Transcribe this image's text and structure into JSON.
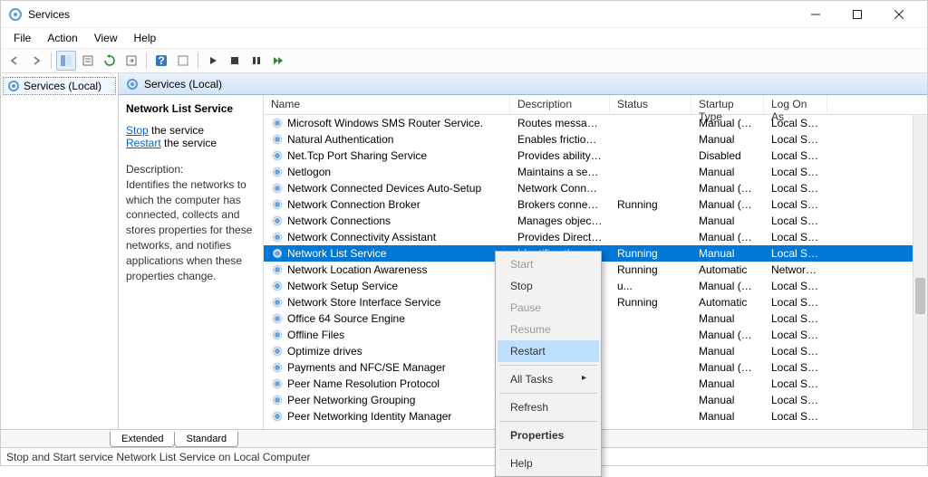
{
  "window": {
    "title": "Services"
  },
  "menubar": [
    "File",
    "Action",
    "View",
    "Help"
  ],
  "nav": {
    "item": "Services (Local)"
  },
  "main_header": {
    "label": "Services (Local)"
  },
  "detail": {
    "service_name": "Network List Service",
    "stop_prefix": "Stop",
    "stop_suffix": " the service",
    "restart_prefix": "Restart",
    "restart_suffix": " the service",
    "desc_label": "Description:",
    "desc_text": "Identifies the networks to which the computer has connected, collects and stores properties for these networks, and notifies applications when these properties change."
  },
  "columns": {
    "name": "Name",
    "desc": "Description",
    "status": "Status",
    "startup": "Startup Type",
    "logon": "Log On As"
  },
  "services": [
    {
      "name": "Microsoft Windows SMS Router Service.",
      "desc": "Routes messages...",
      "status": "",
      "startup": "Manual (Tri...",
      "logon": "Local Syst..."
    },
    {
      "name": "Natural Authentication",
      "desc": "Enables friction-fr...",
      "status": "",
      "startup": "Manual",
      "logon": "Local Syst..."
    },
    {
      "name": "Net.Tcp Port Sharing Service",
      "desc": "Provides ability t...",
      "status": "",
      "startup": "Disabled",
      "logon": "Local Serv..."
    },
    {
      "name": "Netlogon",
      "desc": "Maintains a secur...",
      "status": "",
      "startup": "Manual",
      "logon": "Local Syst..."
    },
    {
      "name": "Network Connected Devices Auto-Setup",
      "desc": "Network Connect...",
      "status": "",
      "startup": "Manual (Tri...",
      "logon": "Local Serv..."
    },
    {
      "name": "Network Connection Broker",
      "desc": "Brokers connecti...",
      "status": "Running",
      "startup": "Manual (Tri...",
      "logon": "Local Syst..."
    },
    {
      "name": "Network Connections",
      "desc": "Manages objects...",
      "status": "",
      "startup": "Manual",
      "logon": "Local Syst..."
    },
    {
      "name": "Network Connectivity Assistant",
      "desc": "Provides DirectAc...",
      "status": "",
      "startup": "Manual (Tri...",
      "logon": "Local Syst..."
    },
    {
      "name": "Network List Service",
      "desc": "Identifies the net...",
      "status": "Running",
      "startup": "Manual",
      "logon": "Local Serv...",
      "selected": true
    },
    {
      "name": "Network Location Awareness",
      "desc": "",
      "status": "Running",
      "startup": "Automatic",
      "logon": "Network ..."
    },
    {
      "name": "Network Setup Service",
      "desc": "",
      "status": "u...",
      "startup": "Manual (Tri...",
      "logon": "Local Syst..."
    },
    {
      "name": "Network Store Interface Service",
      "desc": "",
      "status": "Running",
      "startup": "Automatic",
      "logon": "Local Serv..."
    },
    {
      "name": "Office 64 Source Engine",
      "desc": "",
      "status": "",
      "startup": "Manual",
      "logon": "Local Syst..."
    },
    {
      "name": "Offline Files",
      "desc": "",
      "status": "",
      "startup": "Manual (Tri...",
      "logon": "Local Syst..."
    },
    {
      "name": "Optimize drives",
      "desc": "",
      "status": "",
      "startup": "Manual",
      "logon": "Local Syst..."
    },
    {
      "name": "Payments and NFC/SE Manager",
      "desc": "",
      "status": "",
      "startup": "Manual (Tri...",
      "logon": "Local Serv..."
    },
    {
      "name": "Peer Name Resolution Protocol",
      "desc": "",
      "status": "",
      "startup": "Manual",
      "logon": "Local Serv..."
    },
    {
      "name": "Peer Networking Grouping",
      "desc": "",
      "status": "",
      "startup": "Manual",
      "logon": "Local Serv..."
    },
    {
      "name": "Peer Networking Identity Manager",
      "desc": "",
      "status": "",
      "startup": "Manual",
      "logon": "Local Serv..."
    }
  ],
  "context_menu": {
    "start": "Start",
    "stop": "Stop",
    "pause": "Pause",
    "resume": "Resume",
    "restart": "Restart",
    "alltasks": "All Tasks",
    "refresh": "Refresh",
    "properties": "Properties",
    "help": "Help"
  },
  "tabs": {
    "extended": "Extended",
    "standard": "Standard"
  },
  "statusbar": "Stop and Start service Network List Service on Local Computer"
}
